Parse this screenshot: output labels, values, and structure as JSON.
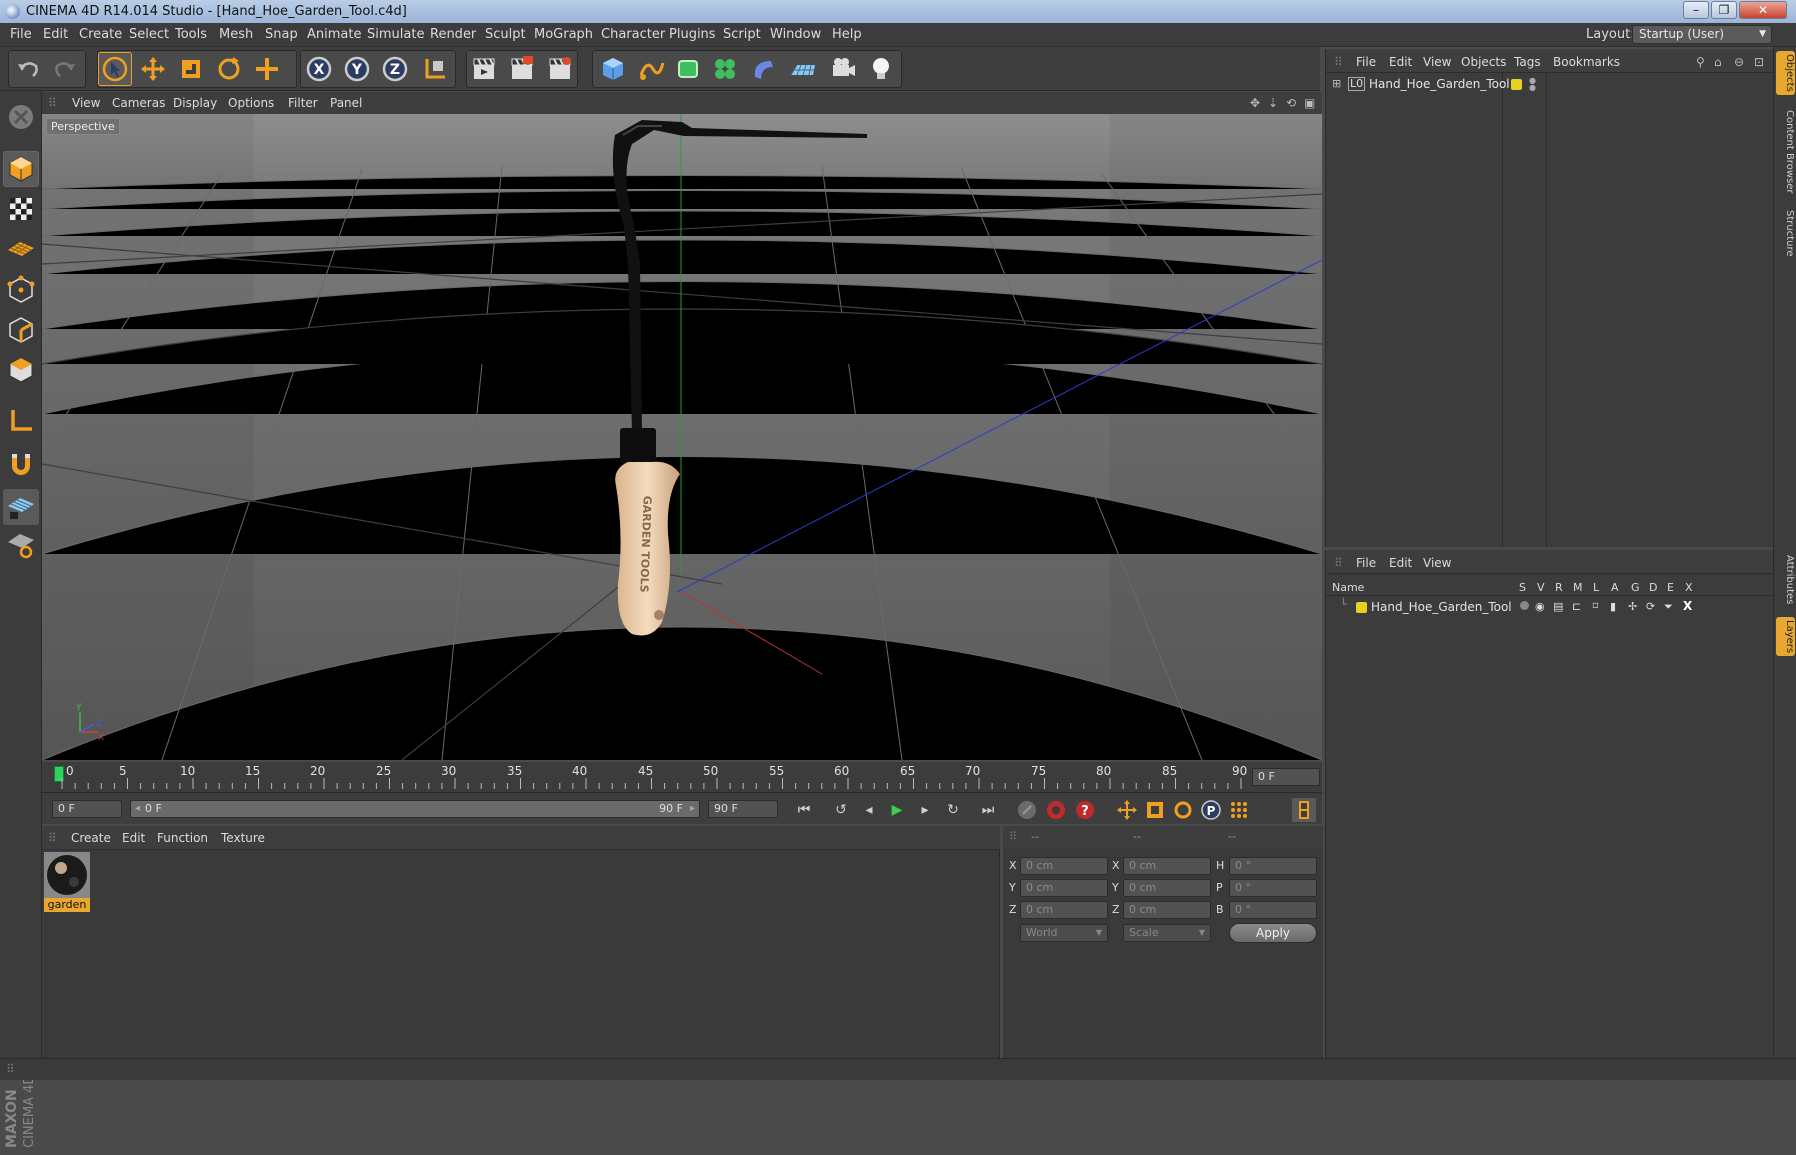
{
  "window": {
    "title": "CINEMA 4D R14.014 Studio - [Hand_Hoe_Garden_Tool.c4d]",
    "minimize": "–",
    "maximize": "❐",
    "close": "✕"
  },
  "menubar": {
    "items": [
      "File",
      "Edit",
      "Create",
      "Select",
      "Tools",
      "Mesh",
      "Snap",
      "Animate",
      "Simulate",
      "Render",
      "Sculpt",
      "MoGraph",
      "Character",
      "Plugins",
      "Script",
      "Window",
      "Help"
    ],
    "layout_label": "Layout:",
    "layout_value": "Startup (User)"
  },
  "viewport": {
    "menus": [
      "View",
      "Cameras",
      "Display",
      "Options",
      "Filter",
      "Panel"
    ],
    "view_name": "Perspective",
    "axis_labels": {
      "y": "Y",
      "z": "Z",
      "x": "X"
    },
    "handle_text": "GARDEN TOOLS"
  },
  "timeline": {
    "ticks": [
      "0",
      "5",
      "10",
      "15",
      "20",
      "25",
      "30",
      "35",
      "40",
      "45",
      "50",
      "55",
      "60",
      "65",
      "70",
      "75",
      "80",
      "85",
      "90"
    ],
    "current_frame": "0 F"
  },
  "transport": {
    "start_field": "0 F",
    "range_start": "0 F",
    "range_end": "90 F",
    "end_field": "90 F"
  },
  "material_manager": {
    "menus": [
      "Create",
      "Edit",
      "Function",
      "Texture"
    ],
    "materials": [
      {
        "name": "garden"
      }
    ]
  },
  "coordinates": {
    "headers": [
      "--",
      "--",
      "--"
    ],
    "rows": [
      {
        "l1": "X",
        "v1": "0 cm",
        "l2": "X",
        "v2": "0 cm",
        "l3": "H",
        "v3": "0 °"
      },
      {
        "l1": "Y",
        "v1": "0 cm",
        "l2": "Y",
        "v2": "0 cm",
        "l3": "P",
        "v3": "0 °"
      },
      {
        "l1": "Z",
        "v1": "0 cm",
        "l2": "Z",
        "v2": "0 cm",
        "l3": "B",
        "v3": "0 °"
      }
    ],
    "space_select": "World",
    "mode_select": "Scale",
    "apply_label": "Apply"
  },
  "object_manager": {
    "menus": [
      "File",
      "Edit",
      "View",
      "Objects",
      "Tags",
      "Bookmarks"
    ],
    "objects": [
      {
        "name": "Hand_Hoe_Garden_Tool",
        "color": "#e6d21e"
      }
    ]
  },
  "layer_manager": {
    "menus": [
      "File",
      "Edit",
      "View"
    ],
    "columns": [
      "Name",
      "S",
      "V",
      "R",
      "M",
      "L",
      "A",
      "G",
      "D",
      "E",
      "X"
    ],
    "layers": [
      {
        "name": "Hand_Hoe_Garden_Tool",
        "color": "#e6d21e"
      }
    ]
  },
  "right_tabs": [
    "Objects",
    "Content Browser",
    "Structure",
    "Attributes",
    "Layers"
  ],
  "branding": {
    "line1": "MAXON",
    "line2": "CINEMA 4D"
  },
  "colors": {
    "accent": "#f0a020",
    "selected_tab": "#e8a830",
    "ui_bg": "#3c3c3c"
  }
}
